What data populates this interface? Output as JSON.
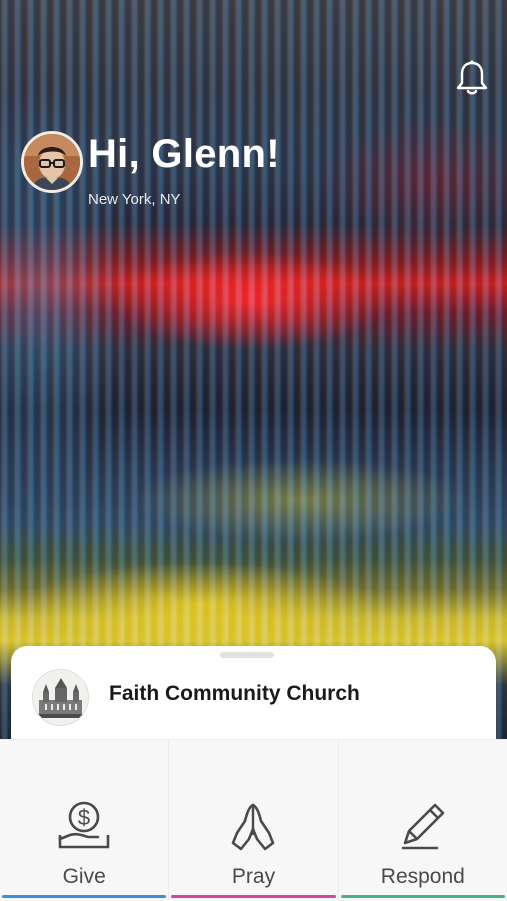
{
  "header": {
    "greeting": "Hi, Glenn!",
    "location": "New York, NY",
    "notification_icon": "bell-icon"
  },
  "church": {
    "name": "Faith Community Church",
    "logo_icon": "church-building-photo"
  },
  "actions": [
    {
      "label": "Give",
      "icon": "money-hand-icon",
      "accent": "#3a8fd6"
    },
    {
      "label": "Pray",
      "icon": "praying-hands-icon",
      "accent": "#d04a9b"
    },
    {
      "label": "Respond",
      "icon": "pencil-icon",
      "accent": "#45b48b"
    }
  ]
}
